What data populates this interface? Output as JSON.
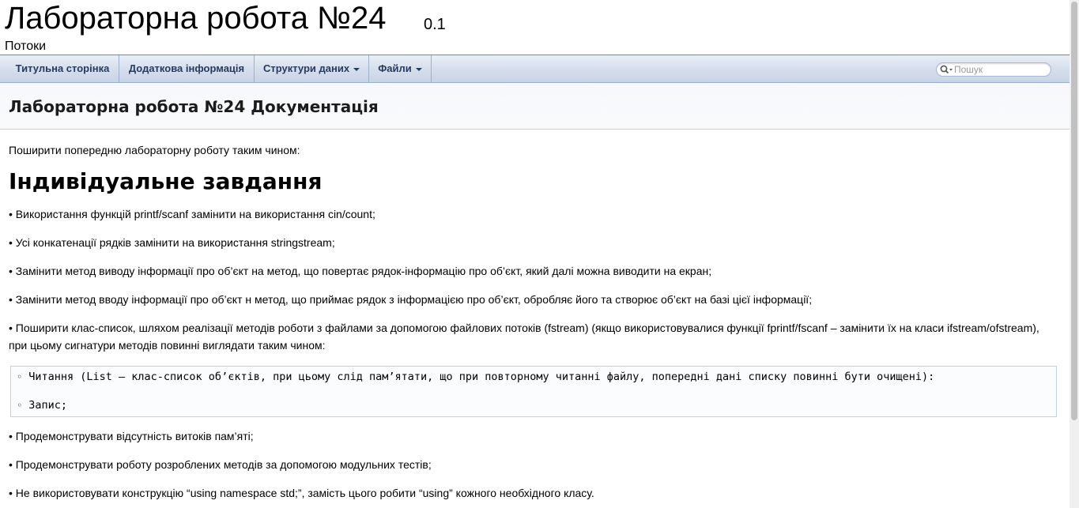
{
  "title_area": {
    "project_name": "Лабораторна робота №24",
    "project_number": "0.1",
    "project_brief": "Потоки"
  },
  "nav": {
    "items": [
      {
        "label": "Титульна сторінка",
        "dropdown": false
      },
      {
        "label": "Додаткова інформація",
        "dropdown": false
      },
      {
        "label": "Структури даних",
        "dropdown": true
      },
      {
        "label": "Файли",
        "dropdown": true
      }
    ],
    "search_placeholder": "Пошук"
  },
  "header": {
    "title": "Лабораторна робота №24 Документація"
  },
  "contents": {
    "intro": "Поширити попередню лабораторну роботу таким чином:",
    "section_heading": "Індивідуальне завдання",
    "bullets_before": [
      "• Використання функцій printf/scanf замінити на використання cin/count;",
      "• Усі конкатенації рядків замінити на використання stringstream;",
      "• Замінити метод виводу інформації про об’єкт на метод, що повертає рядок-інформацію про об’єкт, який далі можна виводити на екран;",
      "• Замінити метод вводу інформації про об’єкт н метод, що приймає рядок з інформацією про об’єкт, обробляє його та створює об’єкт на базі цієї інформації;",
      "• Поширити клас-список, шляхом реалізації методів роботи з файлами за допомогою файлових потоків (fstream) (якщо використовувалися функції fprintf/fscanf – замінити їх на класи ifstream/ofstream), при цьому сигнатури методів повинні виглядати таким чином:"
    ],
    "code_lines": [
      "Читання (List – клас-список об’єктів, при цьому слід пам’ятати, що при повторному читанні файлу, попередні дані списку повинні бути очищені):",
      "Запис;"
    ],
    "code_bullet": "◦",
    "bullets_after": [
      "• Продемонструвати відсутність витоків пам’яті;",
      "• Продемонструвати роботу розроблених методів за допомогою модульних тестів;",
      "• Не використовувати конструкцію “using namespace std;”, замість цього робити “using” кожного необхідного класу."
    ]
  }
}
